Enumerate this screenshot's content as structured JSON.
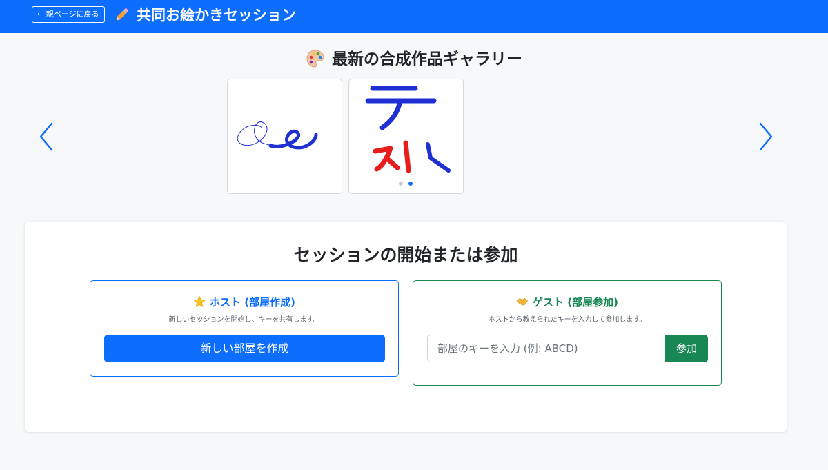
{
  "header": {
    "back_label": "← 親ページに戻る",
    "title": "共同お絵かきセッション",
    "icon": "pencil-icon"
  },
  "gallery": {
    "title": "最新の合成作品ギャラリー",
    "icon": "palette-icon",
    "prev_icon": "chevron-left-icon",
    "next_icon": "chevron-right-icon",
    "active_slide": 2,
    "slide_count": 2
  },
  "session": {
    "title": "セッションの開始または参加",
    "host": {
      "icon": "star-icon",
      "heading": "ホスト (部屋作成)",
      "description": "新しいセッションを開始し、キーを共有します。",
      "button_label": "新しい部屋を作成"
    },
    "guest": {
      "icon": "handshake-icon",
      "heading": "ゲスト (部屋参加)",
      "description": "ホストから教えられたキーを入力して参加します。",
      "input_value": "",
      "input_placeholder": "部屋のキーを入力 (例: ABCD)",
      "button_label": "参加"
    }
  },
  "colors": {
    "primary": "#0d6efd",
    "success": "#198754",
    "background": "#f6f8fa"
  }
}
